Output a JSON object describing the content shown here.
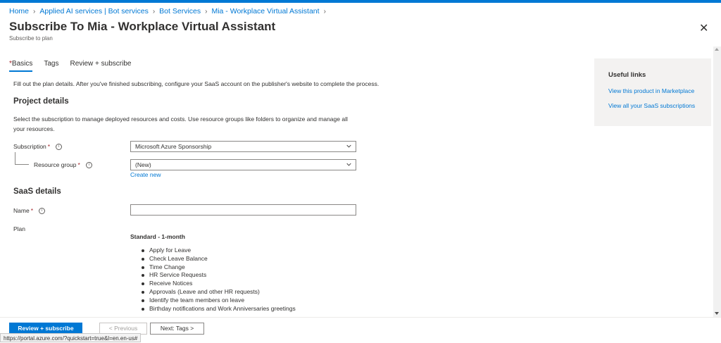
{
  "breadcrumb": [
    "Home",
    "Applied AI services | Bot services",
    "Bot Services",
    "Mia - Workplace Virtual Assistant"
  ],
  "header": {
    "title": "Subscribe To Mia - Workplace Virtual Assistant",
    "ellipsis": "...",
    "subtitle": "Subscribe to plan",
    "close": "✕"
  },
  "tabs": [
    {
      "label": "Basics",
      "required_mark": "*",
      "active": true
    },
    {
      "label": "Tags"
    },
    {
      "label": "Review + subscribe"
    }
  ],
  "intro": "Fill out the plan details. After you've finished subscribing, configure your SaaS account on the publisher's website to complete the process.",
  "project": {
    "heading": "Project details",
    "description": "Select the subscription to manage deployed resources and costs. Use resource groups like folders to organize and manage all your resources.",
    "subscription_label": "Subscription",
    "subscription_value": "Microsoft Azure Sponsorship",
    "resource_group_label": "Resource group",
    "resource_group_value": "(New)",
    "create_new": "Create new"
  },
  "saas": {
    "heading": "SaaS details",
    "name_label": "Name",
    "name_value": "",
    "plan_label": "Plan",
    "plan_name": "Standard - 1-month",
    "plan_features": [
      "Apply for Leave",
      "Check Leave Balance",
      "Time Change",
      "HR Service Requests",
      "Receive Notices",
      "Approvals (Leave and other HR requests)",
      "Identify the team members on leave",
      "Birthday notifications and Work Anniversaries greetings"
    ]
  },
  "required_mark": "*",
  "info_glyph": "i",
  "useful_links": {
    "heading": "Useful links",
    "links": [
      "View this product in Marketplace",
      "View all your SaaS subscriptions"
    ]
  },
  "footer": {
    "review_button": "Review + subscribe",
    "previous_button": "< Previous",
    "next_button": "Next: Tags >"
  },
  "status_url": "https://portal.azure.com/?quickstart=true&l=en.en-us#",
  "colors": {
    "accent": "#0078d4",
    "required": "#a4262c",
    "panel": "#f3f2f1"
  }
}
